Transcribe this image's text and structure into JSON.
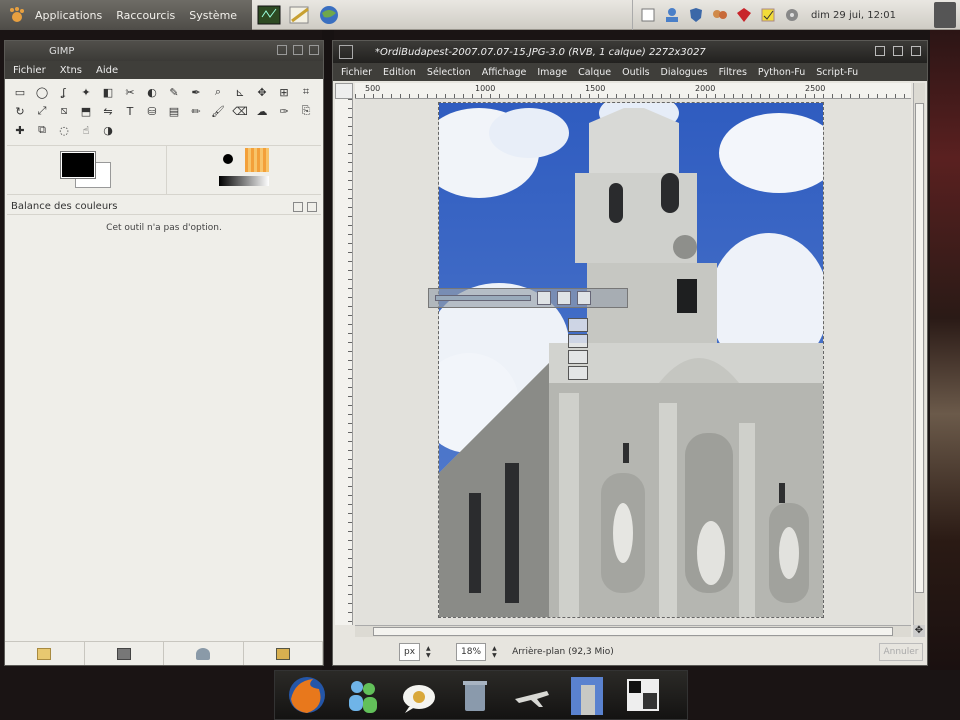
{
  "top_panel": {
    "menus": [
      "Applications",
      "Raccourcis",
      "Système"
    ],
    "clock": "dim 29 jui, 12:01"
  },
  "toolbox": {
    "title": "GIMP",
    "menus": [
      "Fichier",
      "Xtns",
      "Aide"
    ],
    "tool_icons": [
      "rect-select-icon",
      "ellipse-select-icon",
      "lasso-icon",
      "fuzzy-select-icon",
      "color-select-icon",
      "scissors-icon",
      "foreground-select-icon",
      "paths-icon",
      "color-picker-icon",
      "zoom-icon",
      "measure-icon",
      "move-icon",
      "align-icon",
      "crop-icon",
      "rotate-icon",
      "scale-icon",
      "shear-icon",
      "perspective-icon",
      "flip-icon",
      "text-icon",
      "bucket-fill-icon",
      "blend-icon",
      "pencil-icon",
      "paintbrush-icon",
      "eraser-icon",
      "airbrush-icon",
      "ink-icon",
      "clone-icon",
      "heal-icon",
      "perspective-clone-icon",
      "blur-icon",
      "smudge-icon",
      "dodge-burn-icon"
    ],
    "dock_title": "Balance des couleurs",
    "no_options_text": "Cet outil n'a pas d'option."
  },
  "image_window": {
    "title": "*OrdiBudapest-2007.07.07-15.JPG-3.0 (RVB, 1 calque) 2272x3027",
    "menus": [
      "Fichier",
      "Edition",
      "Sélection",
      "Affichage",
      "Image",
      "Calque",
      "Outils",
      "Dialogues",
      "Filtres",
      "Python-Fu",
      "Script-Fu"
    ],
    "ruler_labels": [
      "500",
      "1000",
      "1500",
      "2000",
      "2500"
    ],
    "unit": "px",
    "zoom": "18%",
    "status": "Arrière-plan (92,3 Mio)",
    "cancel_label": "Annuler"
  },
  "colors": {
    "sky": "#3b66c4",
    "building": "#c9cbc6",
    "panel_dark": "#3f3e3a"
  }
}
